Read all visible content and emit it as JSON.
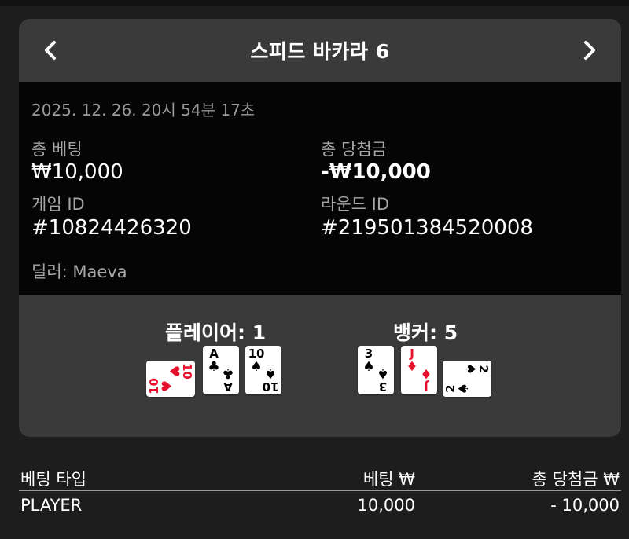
{
  "header": {
    "title": "스피드 바카라 6"
  },
  "info": {
    "datetime": "2025. 12. 26. 20시 54분 17초",
    "total_bet_label": "총 베팅",
    "total_bet_value": "₩10,000",
    "total_win_label": "총 당첨금",
    "total_win_value": "-₩10,000",
    "game_id_label": "게임 ID",
    "game_id_value": "#10824426320",
    "round_id_label": "라운드 ID",
    "round_id_value": "#219501384520008",
    "dealer": "딜러: Maeva"
  },
  "hands": {
    "player_label": "플레이어: 1",
    "banker_label": "뱅커: 5",
    "player_cards": [
      {
        "rank": "10",
        "suit": "♥",
        "color": "#e8112d",
        "rotated": true
      },
      {
        "rank": "A",
        "suit": "♣",
        "color": "#000000",
        "rotated": false
      },
      {
        "rank": "10",
        "suit": "♠",
        "color": "#000000",
        "rotated": false
      }
    ],
    "banker_cards": [
      {
        "rank": "3",
        "suit": "♠",
        "color": "#000000",
        "rotated": false
      },
      {
        "rank": "J",
        "suit": "♦",
        "color": "#e8112d",
        "rotated": false
      },
      {
        "rank": "2",
        "suit": "♠",
        "color": "#000000",
        "rotated": true
      }
    ]
  },
  "bets_table": {
    "headers": [
      "베팅 타입",
      "베팅 ₩",
      "총 당첨금 ₩"
    ],
    "rows": [
      [
        "PLAYER",
        "10,000",
        "- 10,000"
      ]
    ]
  },
  "icons": {
    "prev": "chevron-left-icon",
    "next": "chevron-right-icon"
  },
  "colors": {
    "panel": "#3a3a3a",
    "info_bg": "#050505",
    "page_bg": "#1d1d1d",
    "red_suit": "#e8112d"
  }
}
